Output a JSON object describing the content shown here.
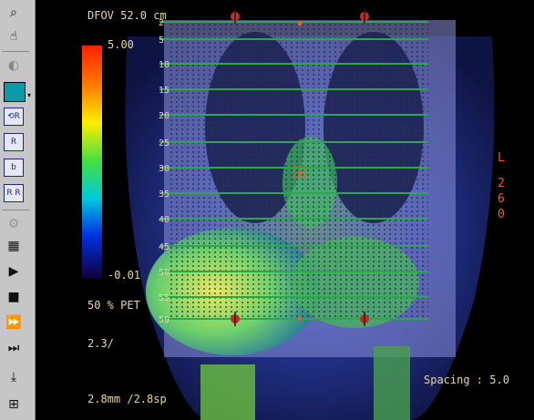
{
  "overlay": {
    "dfov": "DFOV 52.0 cm",
    "scale_max": "5.00",
    "scale_min": "-0.01",
    "blend": "50 % PET",
    "zoom": "2.3/",
    "thickness": "2.8mm /2.8sp",
    "spacing": "Spacing : 5.0",
    "orientation": [
      "L",
      "2",
      "6",
      "0"
    ]
  },
  "slices": [
    "2",
    "5",
    "10",
    "15",
    "20",
    "25",
    "30",
    "35",
    "40",
    "45",
    "50",
    "55",
    "59"
  ],
  "toolbar": {
    "icons": [
      "zoom-icon",
      "pan-hand-icon",
      "window-level-icon",
      "color-swatch-icon",
      "rotate-icon",
      "reference-r-icon",
      "reference-b-icon",
      "reference-rb-icon",
      "grid-icon",
      "play-icon",
      "stop-icon",
      "fast-forward-icon",
      "step-forward-icon",
      "save-icon",
      "layout-icon"
    ]
  },
  "colors": {
    "overlay_text": "#e8d6a8",
    "slice_line": "#2aa84a",
    "accent": "#e4602a",
    "toolbar": "#c6c6c6"
  }
}
